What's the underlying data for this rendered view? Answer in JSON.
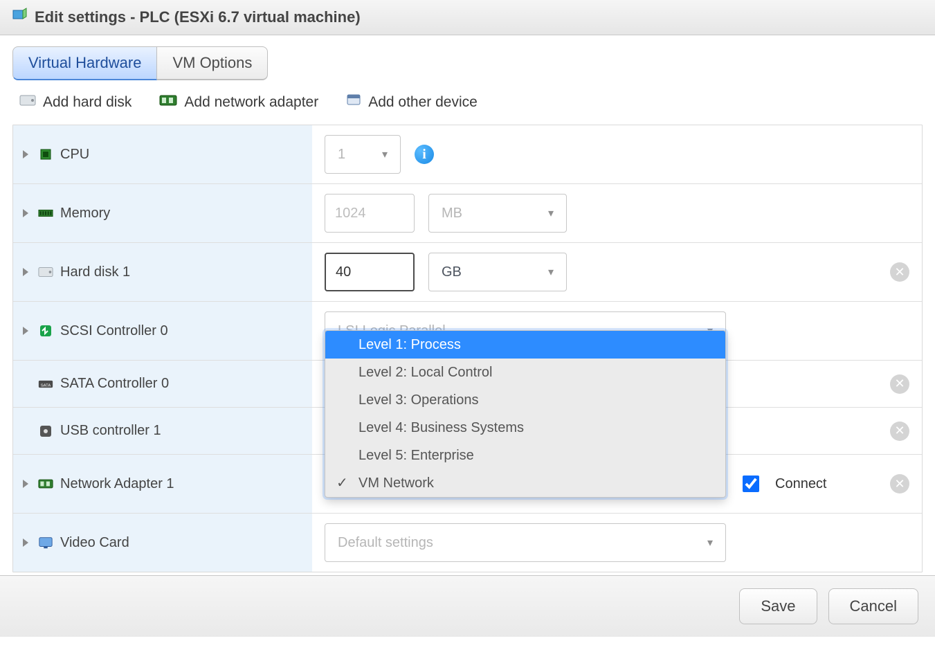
{
  "title": "Edit settings - PLC (ESXi 6.7 virtual machine)",
  "tabs": {
    "hardware": "Virtual Hardware",
    "options": "VM Options"
  },
  "toolbar": {
    "add_disk": "Add hard disk",
    "add_nic": "Add network adapter",
    "add_other": "Add other device"
  },
  "rows": {
    "cpu": {
      "label": "CPU",
      "value": "1"
    },
    "memory": {
      "label": "Memory",
      "value": "1024",
      "unit": "MB"
    },
    "disk": {
      "label": "Hard disk 1",
      "value": "40",
      "unit": "GB"
    },
    "scsi": {
      "label": "SCSI Controller 0",
      "value": "LSI Logic Parallel"
    },
    "sata": {
      "label": "SATA Controller 0"
    },
    "usb": {
      "label": "USB controller 1"
    },
    "nic": {
      "label": "Network Adapter 1",
      "connect": "Connect"
    },
    "video": {
      "label": "Video Card",
      "value": "Default settings"
    }
  },
  "network_options": [
    "Level 1: Process",
    "Level 2: Local Control",
    "Level 3: Operations",
    "Level 4: Business Systems",
    "Level 5: Enterprise",
    "VM Network"
  ],
  "network_selected_index": 5,
  "network_highlight_index": 0,
  "footer": {
    "save": "Save",
    "cancel": "Cancel"
  }
}
